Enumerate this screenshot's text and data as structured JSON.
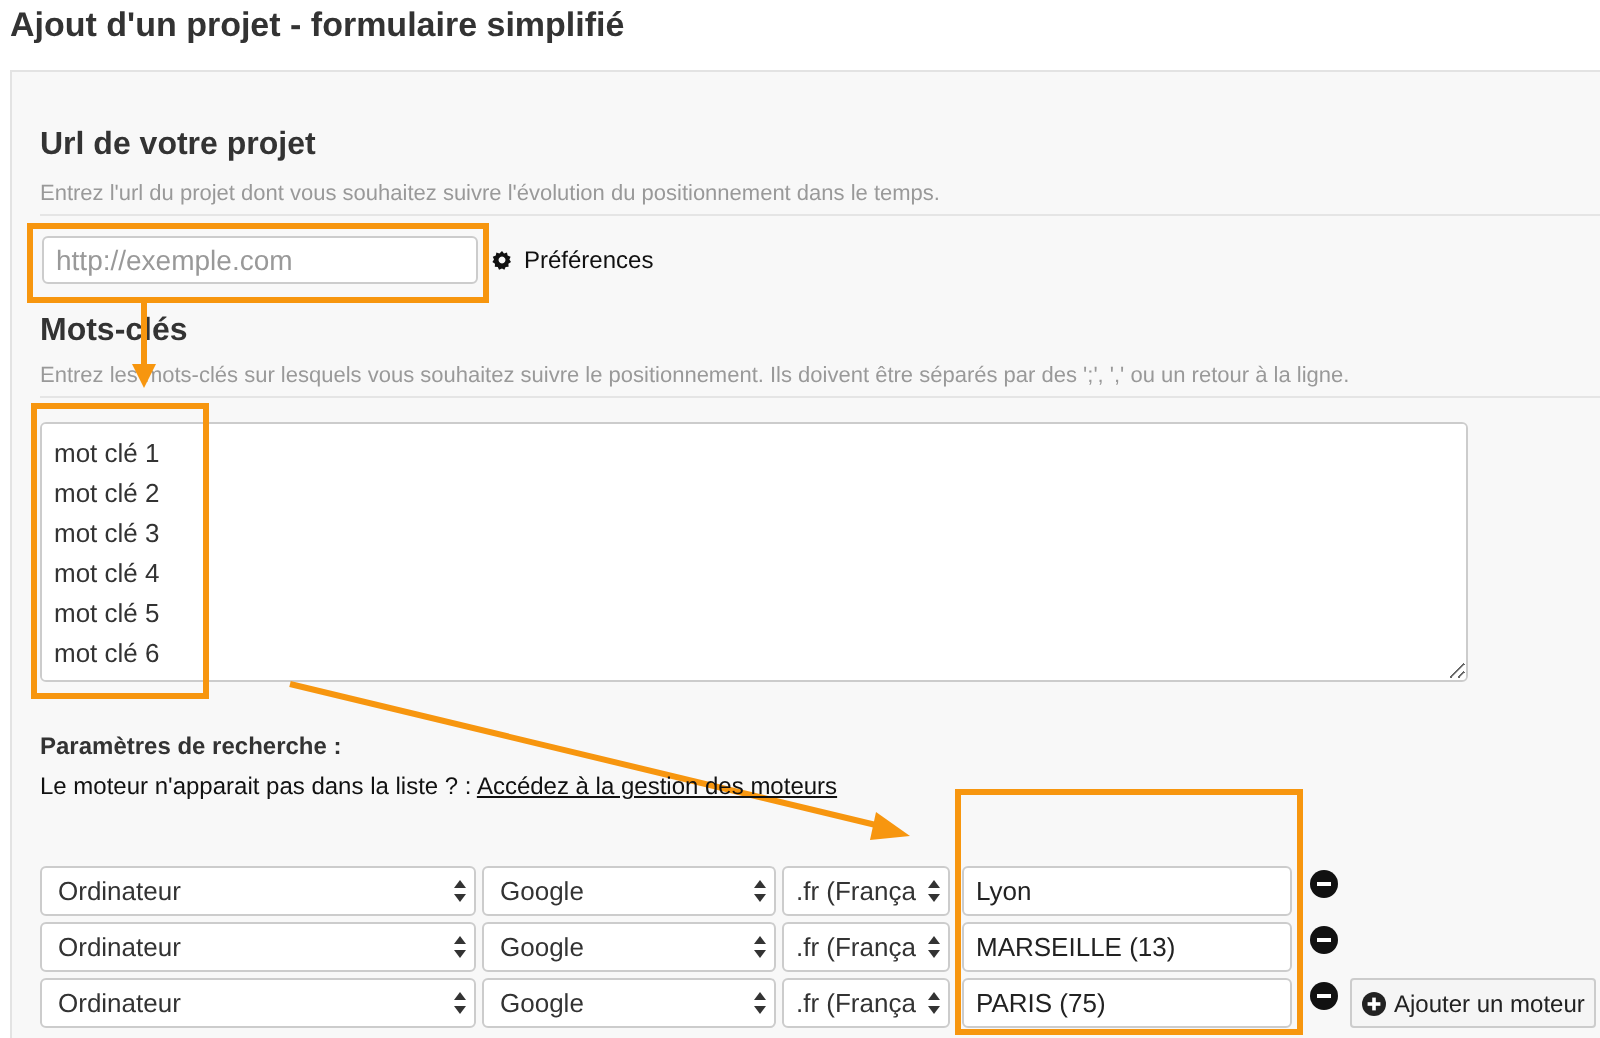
{
  "page_title": "Ajout d'un projet - formulaire simplifié",
  "url_section": {
    "heading": "Url de votre projet",
    "help": "Entrez l'url du projet dont vous souhaitez suivre l'évolution du positionnement dans le temps.",
    "placeholder": "http://exemple.com",
    "preferences_link": "Préférences"
  },
  "keywords_section": {
    "heading": "Mots-clés",
    "help": "Entrez les mots-clés sur lesquels vous souhaitez suivre le positionnement. Ils doivent être séparés par des ';', ',' ou un retour à la ligne.",
    "lines": [
      "mot clé 1",
      "mot clé 2",
      "mot clé 3",
      "mot clé 4",
      "mot clé 5",
      "mot clé 6"
    ]
  },
  "search_params": {
    "heading": "Paramètres de recherche :",
    "note": "Le moteur n'apparait pas dans la liste ? :",
    "link": "Accédez à la gestion des moteurs",
    "rows": [
      {
        "device": "Ordinateur",
        "engine": "Google",
        "domain": ".fr (França",
        "location": "Lyon"
      },
      {
        "device": "Ordinateur",
        "engine": "Google",
        "domain": ".fr (França",
        "location": "MARSEILLE (13)"
      },
      {
        "device": "Ordinateur",
        "engine": "Google",
        "domain": ".fr (França",
        "location": "PARIS (75)"
      }
    ],
    "add_button": "Ajouter un moteur"
  }
}
